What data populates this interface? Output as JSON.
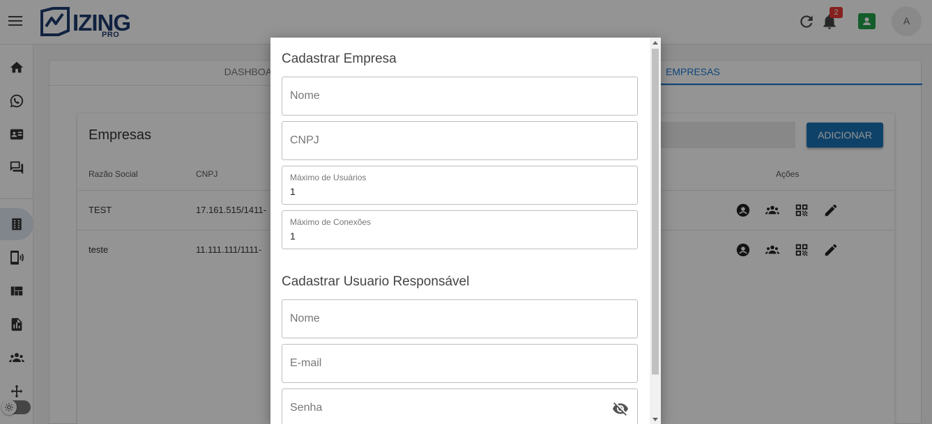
{
  "header": {
    "logo_text": "IZING",
    "logo_sub": "PRO",
    "notifications_count": "2",
    "avatar_letter": "A"
  },
  "sidebar": {
    "items": [
      "home-icon",
      "whatsapp-icon",
      "contacts-icon",
      "chat-icon",
      "building-icon",
      "phone-connection-icon",
      "dashboard-icon",
      "report-icon",
      "users-icon",
      "workflow-icon"
    ],
    "active_index": 4
  },
  "tabs": [
    {
      "label": "DASHBOARD",
      "active": false
    },
    {
      "label": "EMPRESAS",
      "active": true
    }
  ],
  "companies": {
    "title": "Empresas",
    "add_label": "ADICIONAR",
    "columns": {
      "razao": "Razão Social",
      "cnpj": "CNPJ",
      "acoes": "Ações"
    },
    "rows": [
      {
        "razao": "TEST",
        "cnpj": "17.161.515/1411-"
      },
      {
        "razao": "teste",
        "cnpj": "11.111.111/1111-"
      }
    ]
  },
  "modal": {
    "section1_title": "Cadastrar Empresa",
    "nome_placeholder": "Nome",
    "cnpj_placeholder": "CNPJ",
    "max_users_label": "Máximo de Usuários",
    "max_users_value": "1",
    "max_conn_label": "Máximo de Conexões",
    "max_conn_value": "1",
    "section2_title": "Cadastrar Usuario Responsável",
    "user_nome_placeholder": "Nome",
    "email_placeholder": "E-mail",
    "senha_placeholder": "Senha"
  },
  "colors": {
    "accent": "#1976d2",
    "brand": "#1e3b6e",
    "add_button": "#1a73b5",
    "badge": "#e53935",
    "contact_button": "#21a04a"
  }
}
